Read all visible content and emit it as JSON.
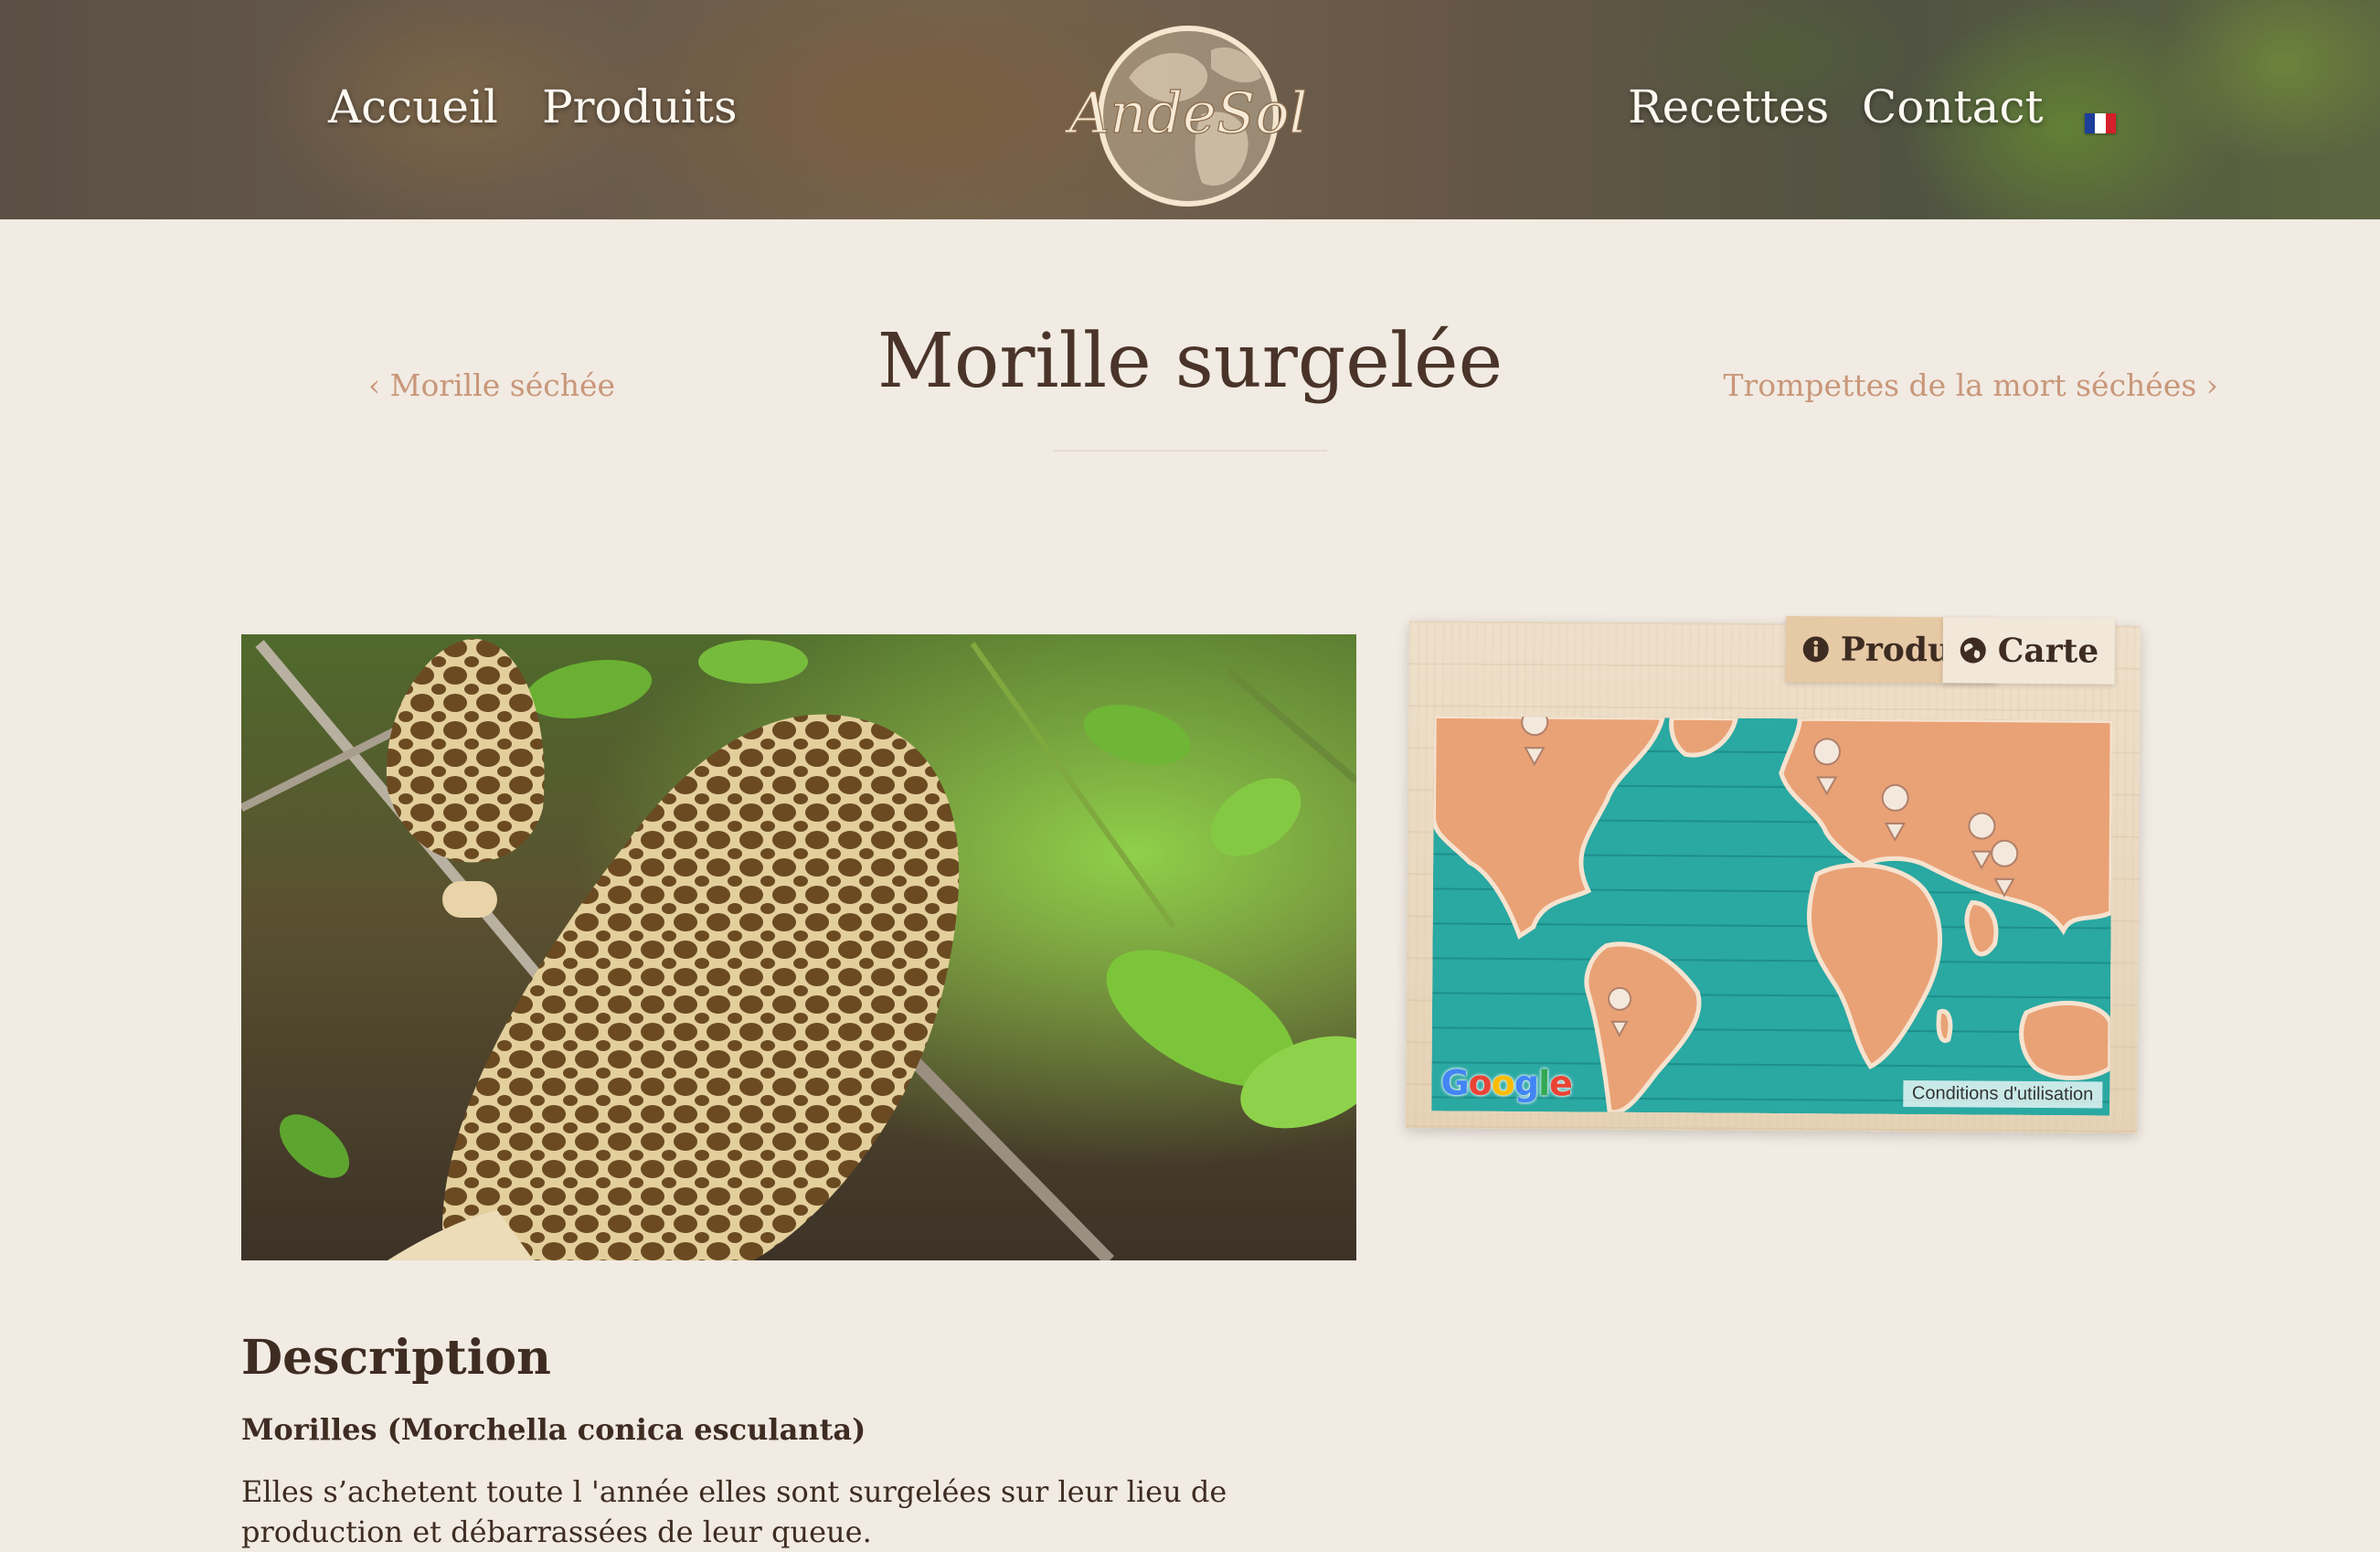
{
  "header": {
    "nav_left": [
      "Accueil",
      "Produits"
    ],
    "nav_right": [
      "Recettes",
      "Contact"
    ],
    "logo_text": "AndeSol",
    "language_flag": "fr-flag-icon"
  },
  "product_nav": {
    "prev_label": "‹ Morille séchée",
    "next_label": "Trompettes de la mort séchées ›"
  },
  "page_title": "Morille surgelée",
  "info_panel": {
    "tabs": [
      {
        "label": "Produit",
        "icon": "info-icon"
      },
      {
        "label": "Carte",
        "icon": "globe-icon"
      }
    ],
    "active_tab": "Carte",
    "map_provider": "Google",
    "terms_label": "Conditions d'utilisation"
  },
  "description": {
    "heading": "Description",
    "subtitle": "Morilles (Morchella conica esculanta)",
    "text": "Elles s’achetent toute l 'année elles sont surgelées sur leur lieu de production et débarrassées de leur queue."
  },
  "colors": {
    "background": "#f1ebe3",
    "title_text": "#4a3429",
    "link_accent": "#c9977a",
    "map_ocean": "#2aa8a2",
    "map_land": "#e9a276"
  }
}
